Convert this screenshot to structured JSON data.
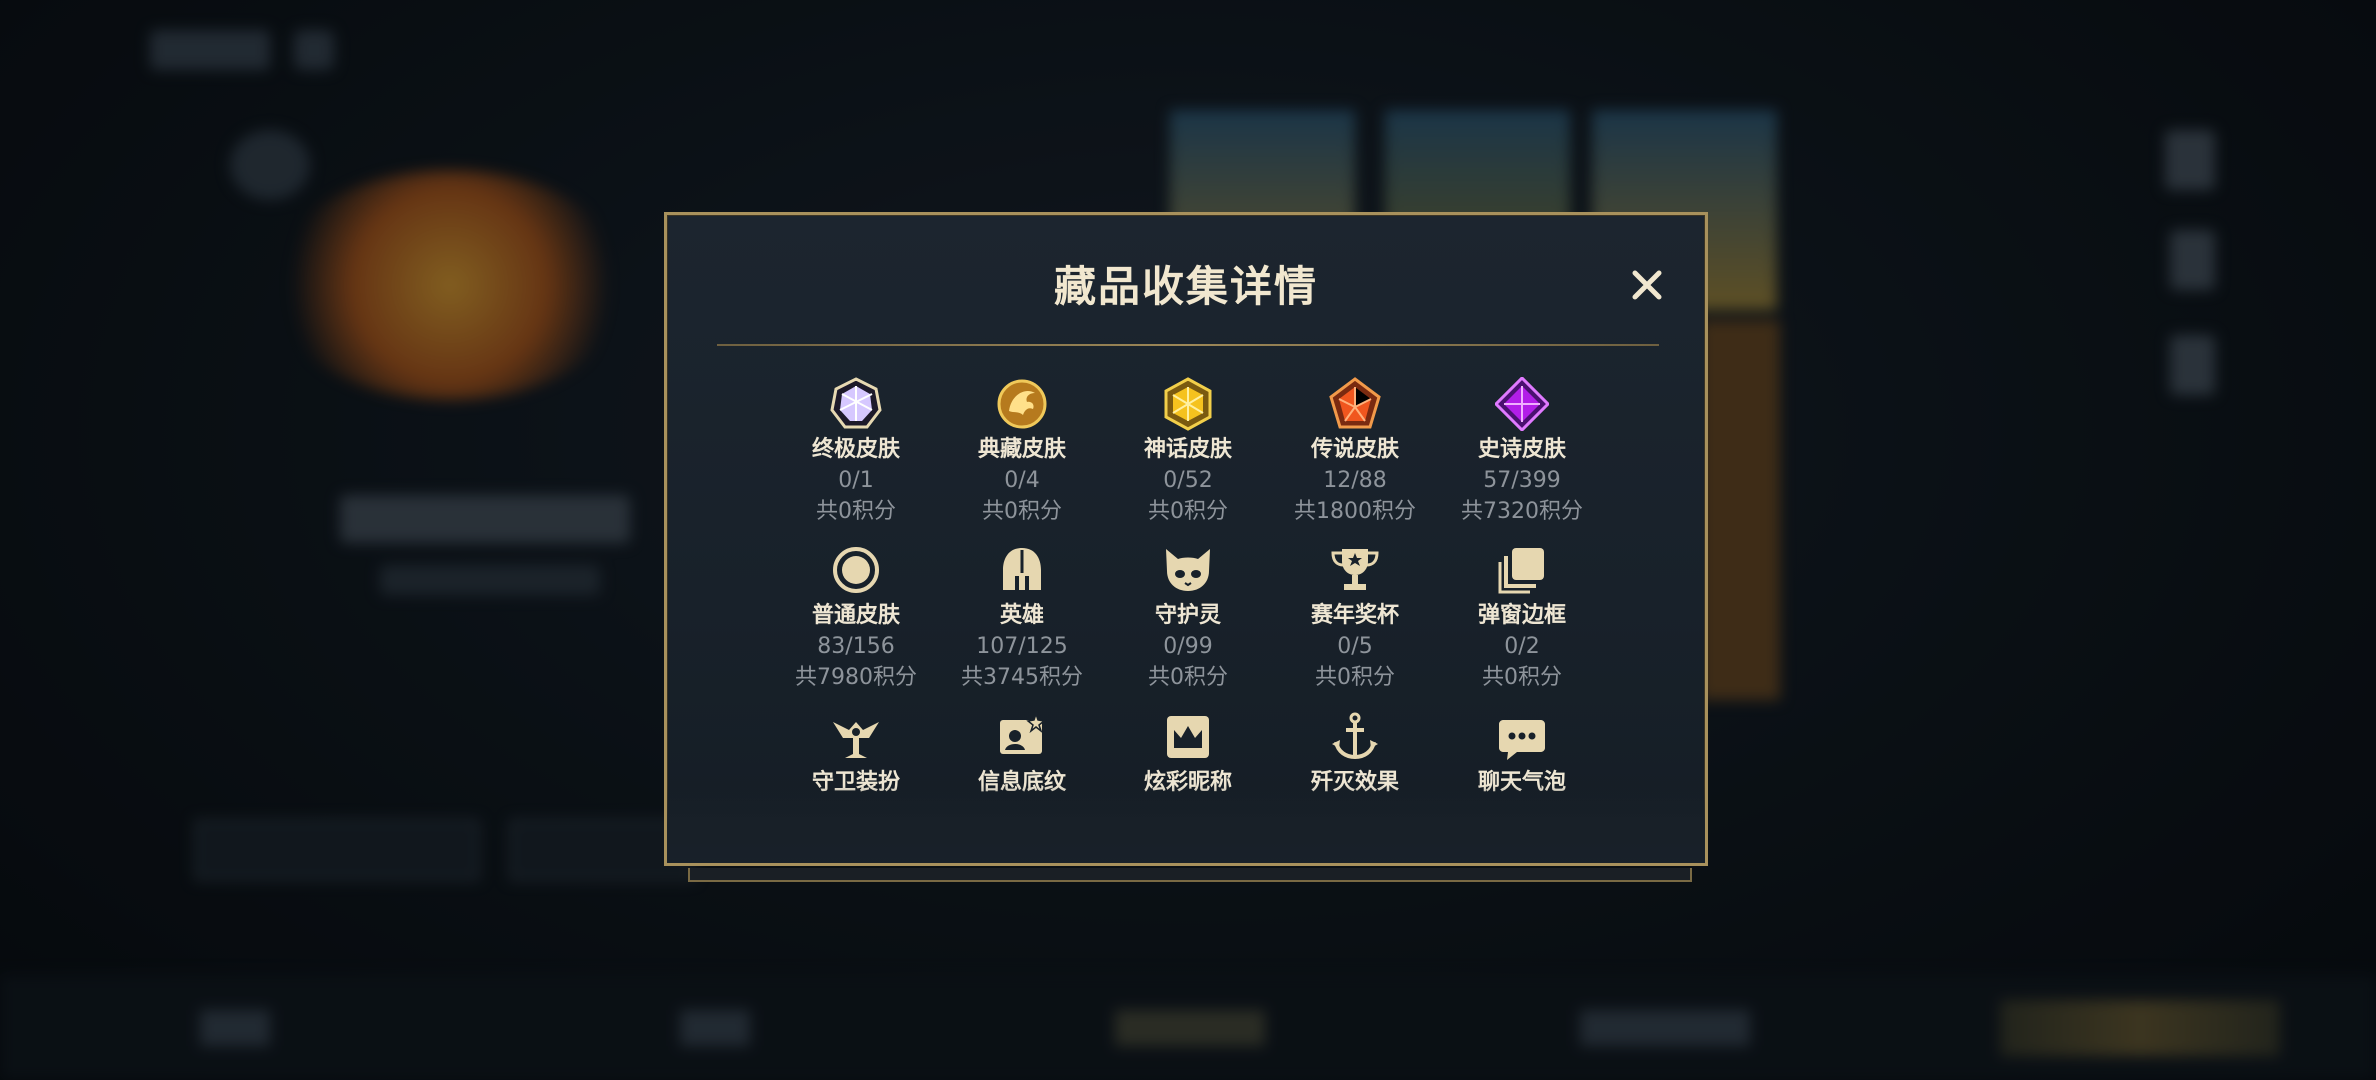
{
  "modal": {
    "title": "藏品收集详情",
    "close_symbol": "✕",
    "items": [
      {
        "name": "终极皮肤",
        "count": "0/1",
        "points": "共0积分",
        "icon": "prism-gem-icon"
      },
      {
        "name": "典藏皮肤",
        "count": "0/4",
        "points": "共0积分",
        "icon": "dragon-emblem-icon"
      },
      {
        "name": "神话皮肤",
        "count": "0/52",
        "points": "共0积分",
        "icon": "gold-gem-icon"
      },
      {
        "name": "传说皮肤",
        "count": "12/88",
        "points": "共1800积分",
        "icon": "orange-gem-icon"
      },
      {
        "name": "史诗皮肤",
        "count": "57/399",
        "points": "共7320积分",
        "icon": "purple-gem-icon"
      },
      {
        "name": "普通皮肤",
        "count": "83/156",
        "points": "共7980积分",
        "icon": "ring-icon"
      },
      {
        "name": "英雄",
        "count": "107/125",
        "points": "共3745积分",
        "icon": "helmet-icon"
      },
      {
        "name": "守护灵",
        "count": "0/99",
        "points": "共0积分",
        "icon": "spirit-face-icon"
      },
      {
        "name": "赛年奖杯",
        "count": "0/5",
        "points": "共0积分",
        "icon": "trophy-icon"
      },
      {
        "name": "弹窗边框",
        "count": "0/2",
        "points": "共0积分",
        "icon": "stacked-frames-icon"
      },
      {
        "name": "守卫装扮",
        "icon": "guard-icon"
      },
      {
        "name": "信息底纹",
        "icon": "info-card-icon"
      },
      {
        "name": "炫彩昵称",
        "icon": "crown-badge-icon"
      },
      {
        "name": "歼灭效果",
        "icon": "anchor-icon"
      },
      {
        "name": "聊天气泡",
        "icon": "chat-bubble-icon"
      }
    ]
  },
  "colors": {
    "gold_border": "#a8915c",
    "title_text": "#f1e7cf",
    "muted_text": "#8e949b",
    "icon_gold": "#e6d7b0"
  }
}
